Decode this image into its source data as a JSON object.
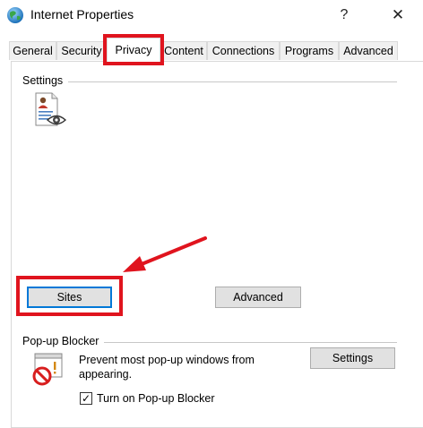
{
  "window": {
    "title": "Internet Properties",
    "help_glyph": "?",
    "close_glyph": "✕"
  },
  "tabs": [
    {
      "label": "General"
    },
    {
      "label": "Security"
    },
    {
      "label": "Privacy",
      "active": true
    },
    {
      "label": "Content"
    },
    {
      "label": "Connections"
    },
    {
      "label": "Programs"
    },
    {
      "label": "Advanced"
    }
  ],
  "settings": {
    "group_label": "Settings",
    "icon": "privacy-settings-icon",
    "sites_button": "Sites",
    "advanced_button": "Advanced"
  },
  "popup_blocker": {
    "group_label": "Pop-up Blocker",
    "icon": "popup-blocked-icon",
    "description": "Prevent most pop-up windows from appearing.",
    "settings_button": "Settings",
    "checkbox_checked": true,
    "checkbox_glyph": "✓",
    "checkbox_label": "Turn on Pop-up Blocker"
  },
  "annotation": {
    "highlight_color": "#e0141e",
    "focus_color": "#0078d7"
  }
}
